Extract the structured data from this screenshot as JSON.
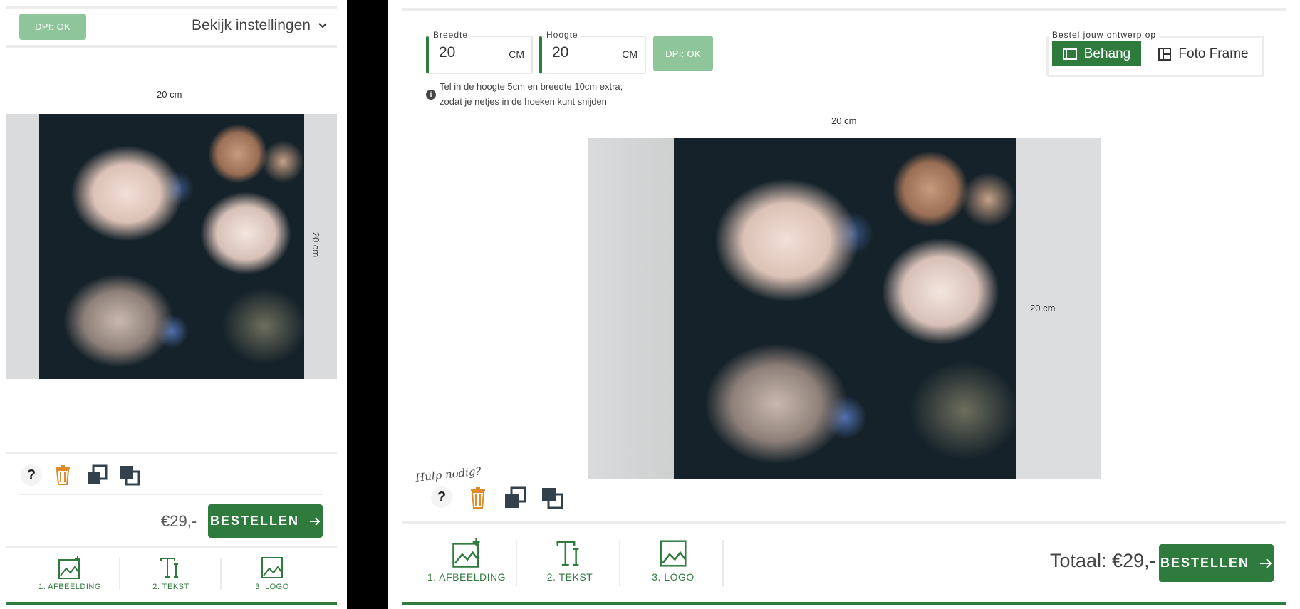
{
  "left_panel": {
    "dpi_button": "DPI: OK",
    "settings_link": "Bekijk instellingen",
    "width_label": "20 cm",
    "height_label": "20 cm",
    "price": "€29,-",
    "order_button": "BESTELLEN",
    "tabs": [
      {
        "label": "1. AFBEELDING",
        "icon": "image-add-icon"
      },
      {
        "label": "2. TEKST",
        "icon": "text-icon"
      },
      {
        "label": "3. LOGO",
        "icon": "image-icon"
      }
    ]
  },
  "right_panel": {
    "width_field": {
      "label": "Breedte",
      "value": "20",
      "unit": "CM"
    },
    "height_field": {
      "label": "Hoogte",
      "value": "20",
      "unit": "CM"
    },
    "dpi_button": "DPI: OK",
    "info_text_1": "Tel in de hoogte 5cm en breedte 10cm extra,",
    "info_text_2": "zodat je netjes in de hoeken kunt snijden",
    "order_on_label": "Bestel jouw ontwerp op",
    "order_on_options": [
      {
        "label": "Behang",
        "icon": "wallpaper-icon",
        "selected": true
      },
      {
        "label": "Foto Frame",
        "icon": "frame-icon",
        "selected": false
      }
    ],
    "width_label": "20 cm",
    "height_label": "20 cm",
    "help_text": "Hulp nodig?",
    "total": "Totaal: €29,-",
    "order_button": "BESTELLEN",
    "tabs": [
      {
        "label": "1. AFBEELDING",
        "icon": "image-add-icon"
      },
      {
        "label": "2. TEKST",
        "icon": "text-icon"
      },
      {
        "label": "3. LOGO",
        "icon": "image-icon"
      }
    ]
  },
  "toolbar_icons": [
    "help-icon",
    "trash-icon",
    "move-backward-icon",
    "move-forward-icon"
  ],
  "colors": {
    "accent": "#2f7a3d",
    "dpi_ok": "#8fc59b",
    "trash": "#e08a2c",
    "canvas_bg": "#d9dbdc"
  }
}
